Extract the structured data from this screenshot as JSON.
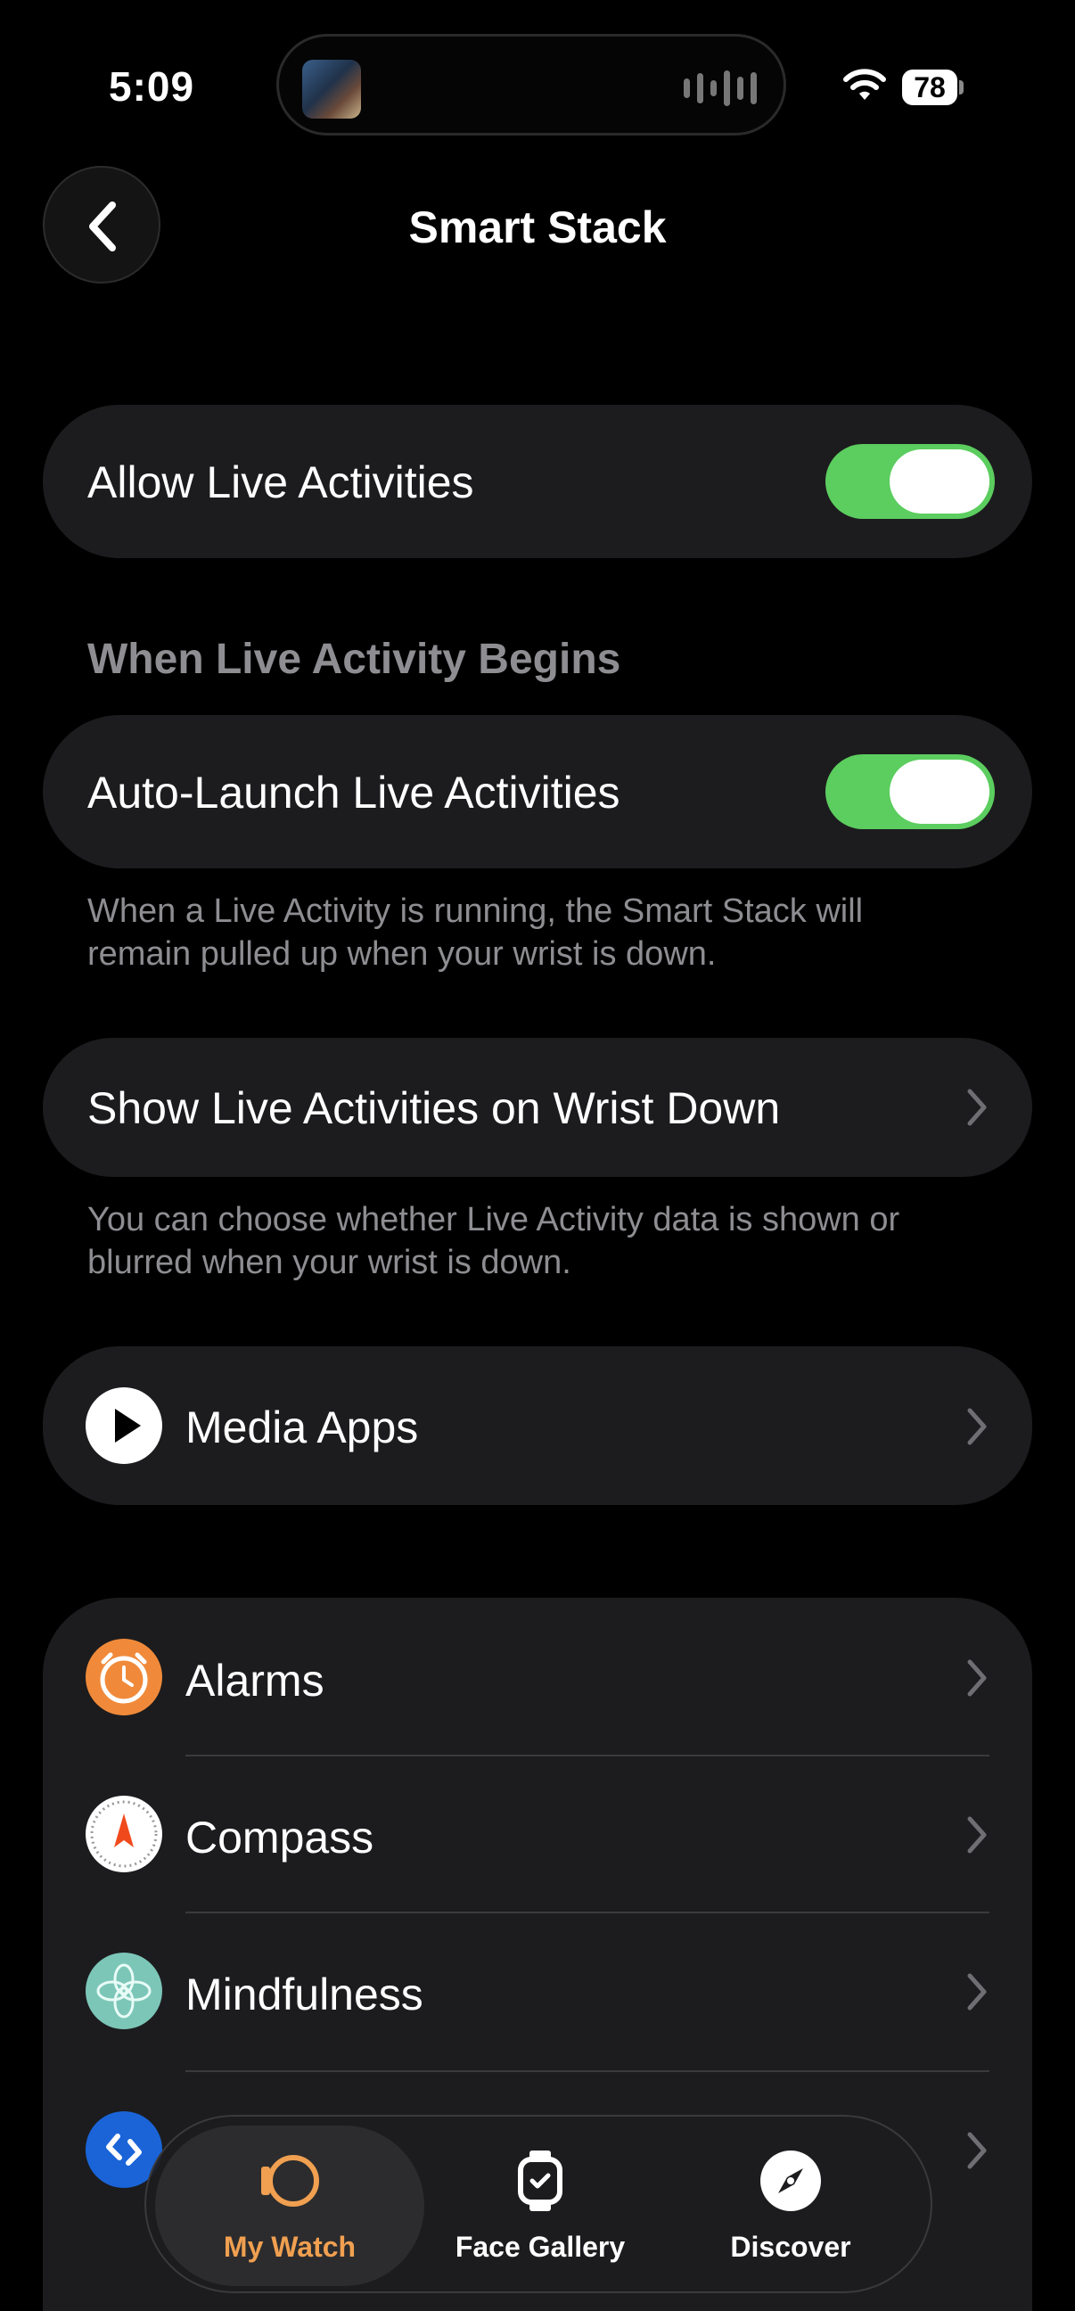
{
  "status_bar": {
    "time": "5:09",
    "battery": "78"
  },
  "nav": {
    "title": "Smart Stack"
  },
  "live_activities": {
    "label": "Allow Live Activities",
    "enabled": true
  },
  "when_begins": {
    "header": "When Live Activity Begins",
    "auto_launch_label": "Auto-Launch Live Activities",
    "auto_launch_enabled": true,
    "footnote_line1": "When a Live Activity is running, the Smart Stack will",
    "footnote_line2": "remain pulled up when your wrist is down."
  },
  "wrist_down": {
    "label": "Show Live Activities on Wrist Down",
    "footnote_line1": "You can choose whether Live Activity data is shown or",
    "footnote_line2": "blurred when your wrist is down."
  },
  "media_apps": {
    "label": "Media Apps"
  },
  "apps": [
    {
      "label": "Alarms",
      "icon": "alarm-clock-icon"
    },
    {
      "label": "Compass",
      "icon": "compass-icon"
    },
    {
      "label": "Mindfulness",
      "icon": "mindfulness-flower-icon"
    },
    {
      "label": "",
      "icon": "shazam-icon"
    }
  ],
  "tabs": [
    {
      "label": "My Watch",
      "icon": "watch-icon",
      "active": true
    },
    {
      "label": "Face Gallery",
      "icon": "watch-face-icon",
      "active": false
    },
    {
      "label": "Discover",
      "icon": "compass-discover-icon",
      "active": false
    }
  ],
  "colors": {
    "toggle_on": "#5ccd5f",
    "accent_orange": "#f0a050",
    "card_bg": "#1c1c1e"
  }
}
